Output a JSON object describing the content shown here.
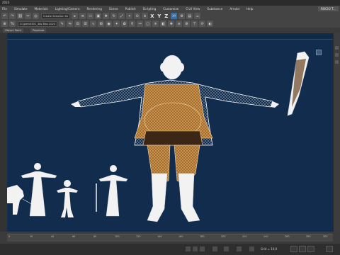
{
  "window": {
    "title": "2023"
  },
  "menu": {
    "items": [
      "File",
      "Edit",
      "Tools",
      "Group",
      "Views",
      "Create",
      "Modifiers",
      "Animation",
      "Graph Editors",
      "Rendering",
      "Customize",
      "Scripting",
      "Content",
      "Civil View",
      "Substance",
      "Arnold",
      "Help"
    ],
    "items_visible": [
      "File",
      "Simulate",
      "Materials",
      "Lighting/Camera",
      "Rendering",
      "Scene",
      "Publish",
      "Scripting",
      "Customize",
      "Civil View",
      "Substance",
      "Arnold",
      "Help"
    ],
    "workspace_badge": "ROCIO T..."
  },
  "toolbar1": {
    "selection_filter": "Create Selection Se",
    "xyz": [
      "X",
      "Y",
      "Z"
    ],
    "xy_constraint": "XY"
  },
  "toolbar2": {
    "file_dropdown": "Cl:\\pem0301_3ds Max 2023"
  },
  "ribbon": {
    "tabs": [
      "Object Paint",
      "Populate"
    ]
  },
  "timeline": {
    "ticks": [
      "0",
      "10",
      "20",
      "30",
      "40",
      "50",
      "60",
      "70",
      "80",
      "90",
      "100",
      "110",
      "120",
      "130",
      "140",
      "150",
      "160",
      "170",
      "180",
      "190",
      "200",
      "210",
      "220",
      "230",
      "240",
      "250",
      "260",
      "270",
      "280",
      "290",
      "300"
    ]
  },
  "status": {
    "grid": "Grid = 10,0"
  },
  "colors": {
    "viewport_bg": "#112c4d",
    "wire_white": "#f2f2f2",
    "wire_orange": "#c98b3c",
    "ui_dark": "#444444"
  }
}
